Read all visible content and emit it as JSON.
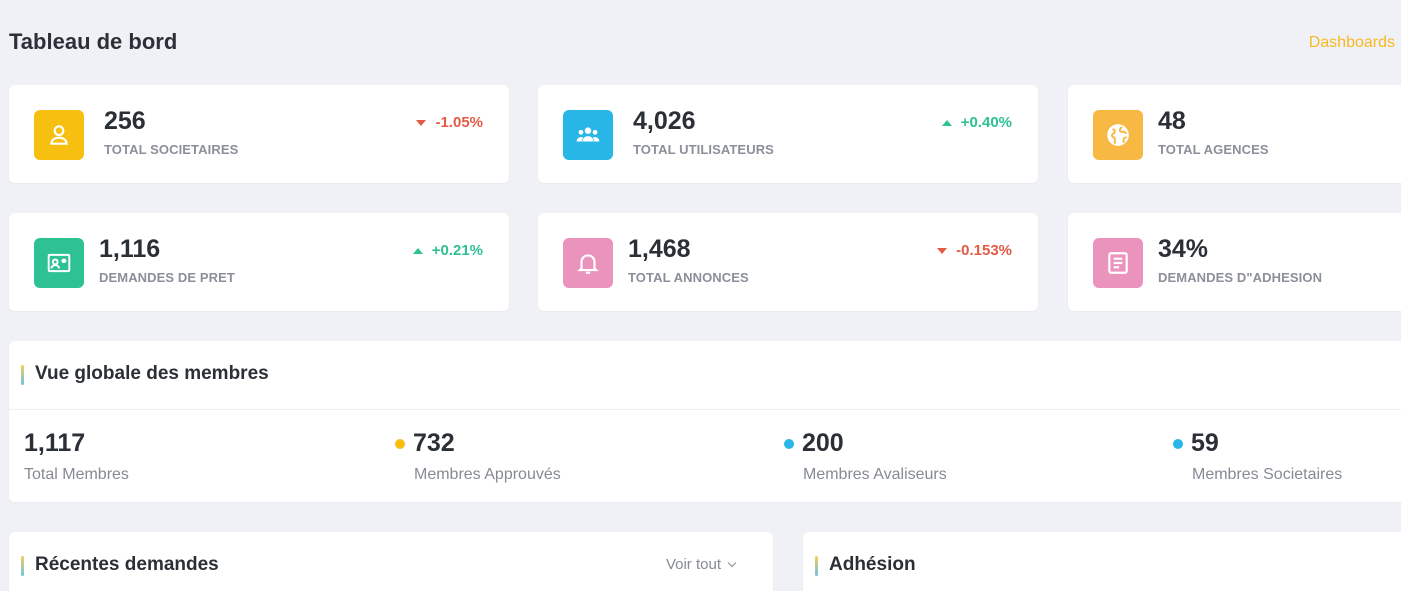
{
  "header": {
    "title": "Tableau de bord",
    "breadcrumb": "Dashboards"
  },
  "stats": [
    {
      "value": "256",
      "label": "TOTAL SOCIETAIRES",
      "change": "-1.05%",
      "trend": "down",
      "icon": "user-icon",
      "color": "#f7bf0f"
    },
    {
      "value": "4,026",
      "label": "TOTAL UTILISATEURS",
      "change": "+0.40%",
      "trend": "up",
      "icon": "group-icon",
      "color": "#27b6e6"
    },
    {
      "value": "48",
      "label": "TOTAL AGENCES",
      "change": "",
      "trend": "",
      "icon": "globe-icon",
      "color": "#f7b944"
    },
    {
      "value": "1,116",
      "label": "DEMANDES DE PRET",
      "change": "+0.21%",
      "trend": "up",
      "icon": "id-card-icon",
      "color": "#2ec193"
    },
    {
      "value": "1,468",
      "label": "TOTAL ANNONCES",
      "change": "-0.153%",
      "trend": "down",
      "icon": "bell-icon",
      "color": "#ea93bd"
    },
    {
      "value": "34%",
      "label": "DEMANDES D\"ADHESION",
      "change": "",
      "trend": "",
      "icon": "document-icon",
      "color": "#ea93bd"
    }
  ],
  "overview": {
    "title": "Vue globale des membres",
    "items": [
      {
        "value": "1,117",
        "label": "Total Membres",
        "dot": ""
      },
      {
        "value": "732",
        "label": "Membres Approuvés",
        "dot": "#f7bf0f"
      },
      {
        "value": "200",
        "label": "Membres Avaliseurs",
        "dot": "#27b6e6"
      },
      {
        "value": "59",
        "label": "Membres Societaires",
        "dot": "#27b6e6"
      }
    ]
  },
  "recent": {
    "title": "Récentes demandes",
    "action": "Voir tout"
  },
  "adhesion": {
    "title": "Adhésion"
  }
}
